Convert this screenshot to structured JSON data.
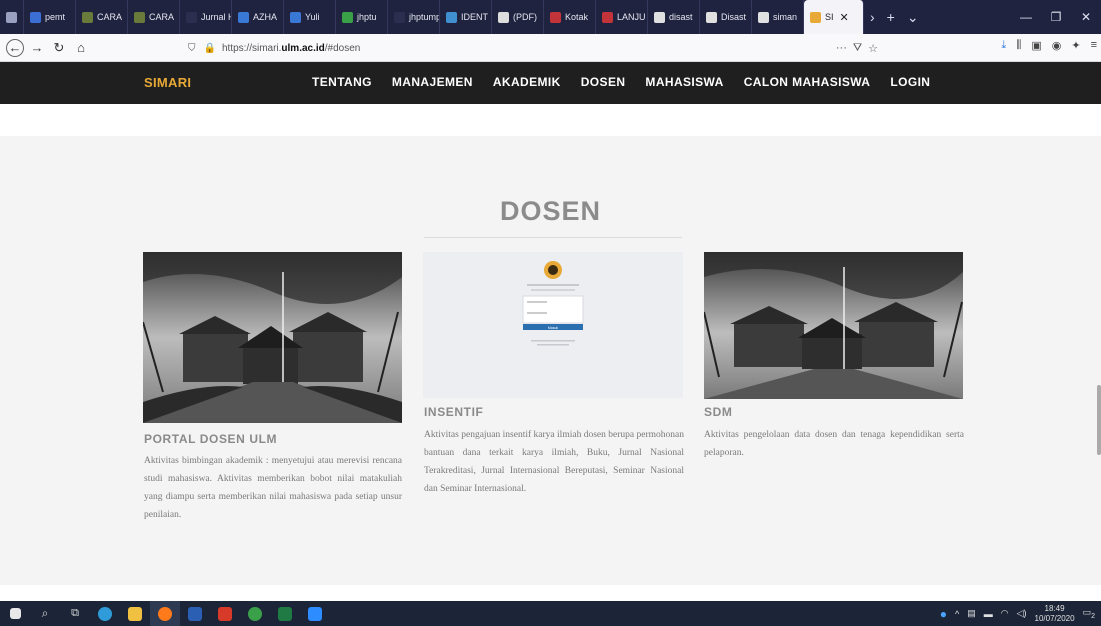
{
  "browser": {
    "tabs": [
      {
        "label": "",
        "color": "#9aa0c0"
      },
      {
        "label": "pemt",
        "color": "#3b6fd6"
      },
      {
        "label": "CARA",
        "color": "#6a7a3a"
      },
      {
        "label": "CARA",
        "color": "#6a7a3a"
      },
      {
        "label": "Jurnal Has",
        "color": "#2a2f50"
      },
      {
        "label": "AZHA",
        "color": "#3a78d6"
      },
      {
        "label": "Yuli",
        "color": "#3a78d6"
      },
      {
        "label": "jhptu",
        "color": "#3aa047"
      },
      {
        "label": "jhptump-",
        "color": "#2a2f50"
      },
      {
        "label": "IDENT",
        "color": "#3f8fd1"
      },
      {
        "label": "(PDF)",
        "color": "#dddddd"
      },
      {
        "label": "Kotak",
        "color": "#c3333a"
      },
      {
        "label": "LANJU",
        "color": "#c3333a"
      },
      {
        "label": "disast",
        "color": "#e0e0e0"
      },
      {
        "label": "Disast",
        "color": "#e0e0e0"
      },
      {
        "label": "siman",
        "color": "#e0e0e0"
      },
      {
        "label": "SI",
        "color": "#e8a936",
        "active": true
      }
    ],
    "url_prefix": "https://simari.",
    "url_host": "ulm.ac.id",
    "url_suffix": "/#dosen"
  },
  "site": {
    "brand": "SIMARI",
    "menu": [
      "TENTANG",
      "MANAJEMEN",
      "AKADEMIK",
      "DOSEN",
      "MAHASISWA",
      "CALON MAHASISWA",
      "LOGIN"
    ]
  },
  "section": {
    "title": "DOSEN",
    "cards": [
      {
        "title": "PORTAL DOSEN ULM",
        "text": "Aktivitas bimbingan akademik : menyetujui atau merevisi rencana studi mahasiswa. Aktivitas memberikan bobot nilai matakuliah yang diampu serta memberikan nilai mahasiswa pada setiap unsur penilaian."
      },
      {
        "title": "INSENTIF",
        "text": "Aktivitas pengajuan insentif karya ilmiah dosen berupa permohonan bantuan dana terkait karya ilmiah, Buku, Jurnal Nasional Terakreditasi, Jurnal Internasional Bereputasi, Seminar Nasional dan Seminar Internasional.",
        "login_button": "Masuk"
      },
      {
        "title": "SDM",
        "text": "Aktivitas pengelolaan data dosen dan tenaga kependidikan serta pelaporan."
      }
    ]
  },
  "taskbar": {
    "time": "18:49",
    "date": "10/07/2020",
    "notification_count": "2"
  },
  "colors": {
    "brand": "#e8a936",
    "header_bg": "#1f1f1f",
    "login_button": "#2b6fb0"
  }
}
